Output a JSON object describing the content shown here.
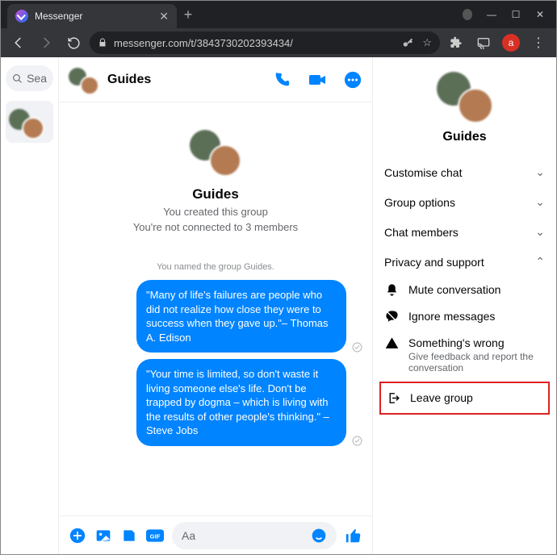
{
  "browser": {
    "tab_title": "Messenger",
    "url": "messenger.com/t/3843730202393434/",
    "avatar_letter": "a"
  },
  "sidebar": {
    "search_placeholder": "Sea"
  },
  "chat": {
    "title": "Guides",
    "intro_title": "Guides",
    "intro_line1": "You created this group",
    "intro_line2": "You're not connected to 3 members",
    "system_msg": "You named the group Guides.",
    "messages": [
      "\"Many of life's failures are people who did not realize how close they were to success when they gave up.\"– Thomas A. Edison",
      "\"Your time is limited, so don't waste it living someone else's life. Don't be trapped by dogma – which is living with the results of other people's thinking.\" – Steve Jobs"
    ],
    "composer_placeholder": "Aa"
  },
  "details": {
    "title": "Guides",
    "sections": {
      "customise": "Customise chat",
      "group_options": "Group options",
      "chat_members": "Chat members",
      "privacy": "Privacy and support"
    },
    "privacy_items": {
      "mute": "Mute conversation",
      "ignore": "Ignore messages",
      "wrong_title": "Something's wrong",
      "wrong_sub": "Give feedback and report the conversation",
      "leave": "Leave group"
    }
  }
}
